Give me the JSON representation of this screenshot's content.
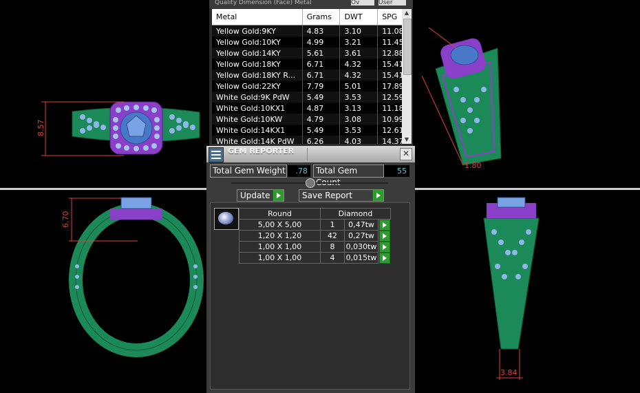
{
  "metal_panel": {
    "top_fields": [
      "Quality Dimension (Face) Metal",
      "Ov",
      "User"
    ],
    "columns": [
      "Metal",
      "Grams",
      "DWT",
      "SPG"
    ],
    "rows": [
      [
        "Yellow Gold:9KY",
        "4.83",
        "3.10",
        "11.08"
      ],
      [
        "Yellow Gold:10KY",
        "4.99",
        "3.21",
        "11.45"
      ],
      [
        "Yellow Gold:14KY",
        "5.61",
        "3.61",
        "12.88"
      ],
      [
        "Yellow Gold:18KY",
        "6.71",
        "4.32",
        "15.41"
      ],
      [
        "Yellow Gold:18KY R...",
        "6.71",
        "4.32",
        "15.41"
      ],
      [
        "Yellow Gold:22KY",
        "7.79",
        "5.01",
        "17.89"
      ],
      [
        "White Gold:9K PdW",
        "5.49",
        "3.53",
        "12.59"
      ],
      [
        "White Gold:10KX1",
        "4.87",
        "3.13",
        "11.18"
      ],
      [
        "White Gold:10KW",
        "4.79",
        "3.08",
        "10.99"
      ],
      [
        "White Gold:14KX1",
        "5.49",
        "3.53",
        "12.61"
      ],
      [
        "White Gold:14K PdW",
        "6.26",
        "4.03",
        "14.37"
      ]
    ]
  },
  "gem_reporter": {
    "title": "GEM REPORTER",
    "total_weight_label": "Total Gem Weight",
    "total_weight_value": ".78",
    "total_count_label": "Total Gem Count",
    "total_count_value": "55",
    "update_label": "Update",
    "save_report_label": "Save Report",
    "shape_header": "Round",
    "type_header": "Diamond",
    "gems": [
      {
        "size": "5,00 X 5,00",
        "count": "1",
        "weight": "0,47tw"
      },
      {
        "size": "1,20 X 1,20",
        "count": "42",
        "weight": "0,27tw"
      },
      {
        "size": "1,00 X 1,00",
        "count": "8",
        "weight": "0,030tw"
      },
      {
        "size": "1,00 X 1,00",
        "count": "4",
        "weight": "0,015tw"
      }
    ]
  },
  "views": {
    "top_left_dimension": "8.57",
    "bottom_left_dimension": "6.70",
    "top_right_dimension": "1.80",
    "bottom_right_dimension": "3.84"
  },
  "colors": {
    "metal_green": "#1f8a5a",
    "halo_purple": "#8a3fc9",
    "gem_blue": "#7fa6e6",
    "dimension_red": "#e0413a"
  }
}
